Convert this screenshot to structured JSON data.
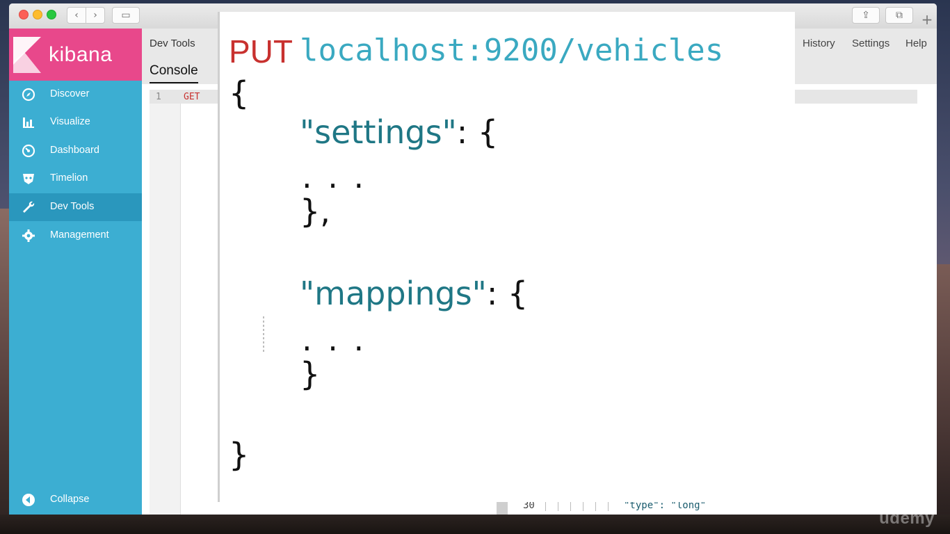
{
  "browser": {
    "back_icon": "‹",
    "forward_icon": "›",
    "sidebar_icon": "▭",
    "share_icon": "⇪",
    "tabs_icon": "⧉",
    "newtab_icon": "+"
  },
  "kibana": {
    "brand": "kibana",
    "nav": [
      {
        "label": "Discover",
        "icon": "compass-icon"
      },
      {
        "label": "Visualize",
        "icon": "bar-chart-icon"
      },
      {
        "label": "Dashboard",
        "icon": "gauge-icon"
      },
      {
        "label": "Timelion",
        "icon": "timelion-icon"
      },
      {
        "label": "Dev Tools",
        "icon": "wrench-icon",
        "active": true
      },
      {
        "label": "Management",
        "icon": "gear-icon"
      }
    ],
    "collapse": "Collapse"
  },
  "devtools": {
    "title": "Dev Tools",
    "tab": "Console",
    "links": {
      "history": "History",
      "settings": "Settings",
      "help": "Help"
    },
    "editor": {
      "line_number": "1",
      "line_text": "GET",
      "bottom_line_number": "30",
      "bottom_line_text": "\"type\": \"long\""
    }
  },
  "slide": {
    "method": "PUT",
    "url": "localhost:9200/vehicles",
    "lines": {
      "open": "{",
      "settings_key": "\"settings\"",
      "settings_open": ": {",
      "settings_ellipsis": ". . .",
      "settings_close": "},",
      "mappings_key": "\"mappings\"",
      "mappings_open": ": {",
      "mappings_ellipsis": ". . .",
      "mappings_close": "}",
      "close": "}"
    }
  },
  "watermark": "udemy",
  "colors": {
    "kibana_pink": "#e8488b",
    "kibana_blue": "#3caed2",
    "active_nav": "#2a97bd",
    "method_red": "#c8312f",
    "url_teal": "#3aa9c1",
    "key_teal": "#1f7785"
  }
}
